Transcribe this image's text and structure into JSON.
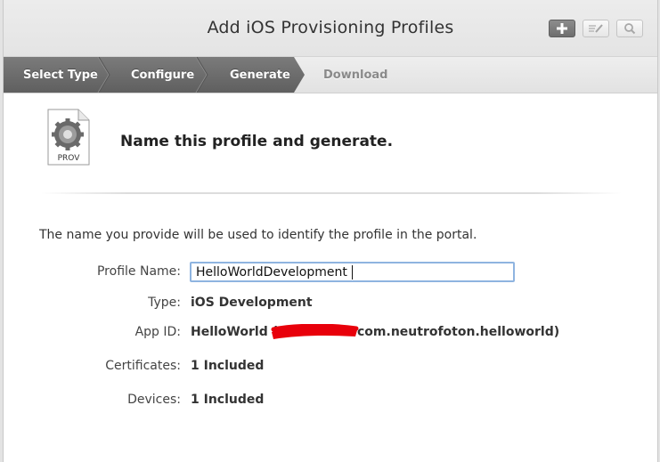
{
  "window": {
    "title": "Add iOS Provisioning Profiles"
  },
  "toolbar": {
    "add_icon": "plus-icon",
    "edit_icon": "pencil-icon",
    "search_icon": "magnifier-icon"
  },
  "steps": [
    {
      "label": "Select Type",
      "state": "done"
    },
    {
      "label": "Configure",
      "state": "done"
    },
    {
      "label": "Generate",
      "state": "current"
    },
    {
      "label": "Download",
      "state": "todo"
    }
  ],
  "section": {
    "icon_label": "PROV",
    "heading": "Name this profile and generate."
  },
  "intro": "The name you provide will be used to identify the profile in the portal.",
  "form": {
    "profile_name_label": "Profile Name:",
    "profile_name_value": "HelloWorldDevelopment",
    "type_label": "Type:",
    "type_value": "iOS Development",
    "app_id_label": "App ID:",
    "app_id_name": "HelloWorld (",
    "app_id_bundle": "com.neutrofoton.helloworld)",
    "certificates_label": "Certificates:",
    "certificates_value": "1 Included",
    "devices_label": "Devices:",
    "devices_value": "1 Included"
  },
  "colors": {
    "step_active": "#6f6f6f",
    "input_focus_border": "#8fb4e0",
    "redaction": "#e8000b"
  }
}
